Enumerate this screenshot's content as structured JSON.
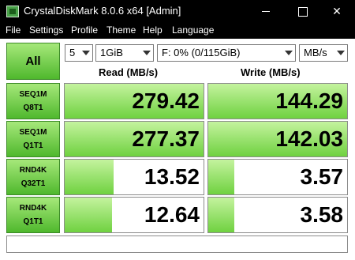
{
  "window": {
    "title": "CrystalDiskMark 8.0.6 x64 [Admin]"
  },
  "menu": [
    "File",
    "Settings",
    "Profile",
    "Theme",
    "Help",
    "Language"
  ],
  "controls": {
    "all_label": "All",
    "test_count": "5",
    "test_size": "1GiB",
    "drive": "F: 0% (0/115GiB)",
    "unit": "MB/s"
  },
  "headers": {
    "read": "Read (MB/s)",
    "write": "Write (MB/s)"
  },
  "tests": [
    {
      "line1": "SEQ1M",
      "line2": "Q8T1",
      "read": "279.42",
      "write": "144.29",
      "read_fill": 1.0,
      "write_fill": 1.0
    },
    {
      "line1": "SEQ1M",
      "line2": "Q1T1",
      "read": "277.37",
      "write": "142.03",
      "read_fill": 1.0,
      "write_fill": 1.0
    },
    {
      "line1": "RND4K",
      "line2": "Q32T1",
      "read": "13.52",
      "write": "3.57",
      "read_fill": 0.35,
      "write_fill": 0.19
    },
    {
      "line1": "RND4K",
      "line2": "Q1T1",
      "read": "12.64",
      "write": "3.58",
      "read_fill": 0.34,
      "write_fill": 0.19
    }
  ],
  "comment": "",
  "colors": {
    "accent_green": "#4fb82d",
    "bar_green": "#6fd140",
    "titlebar": "#000000"
  }
}
